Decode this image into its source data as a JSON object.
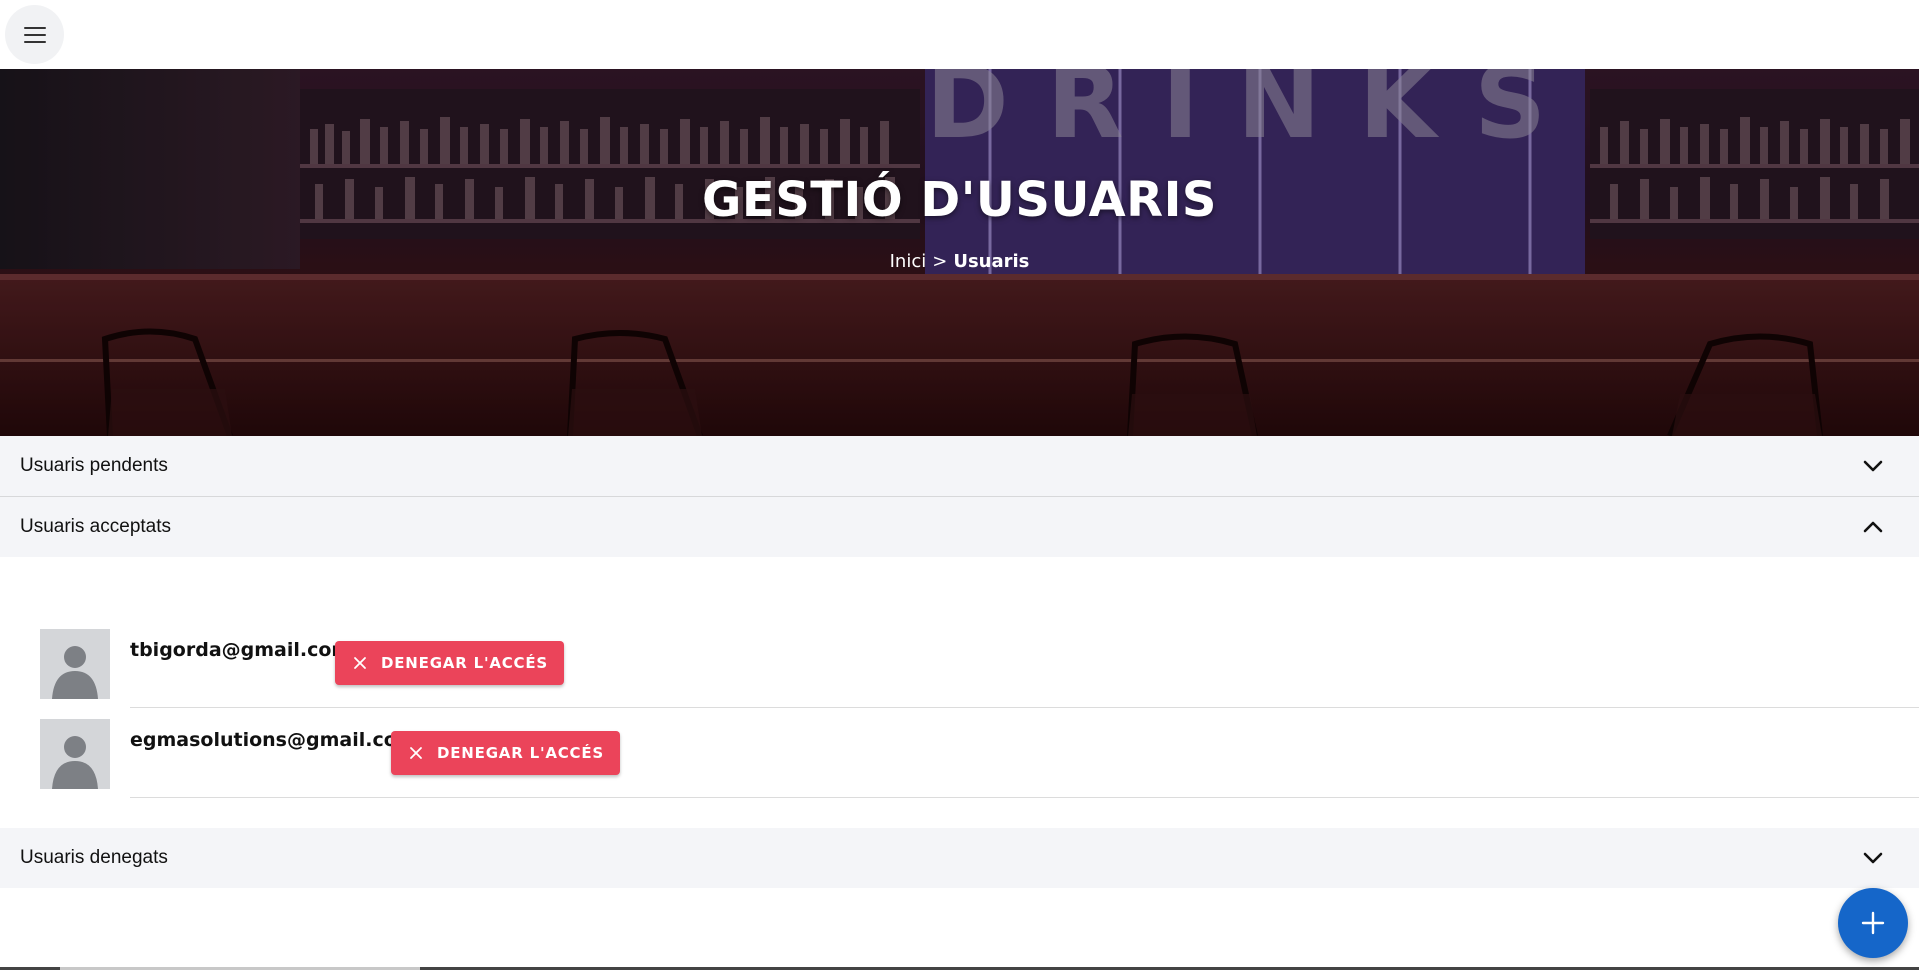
{
  "topbar": {
    "menu_icon": "hamburger-menu-icon"
  },
  "hero": {
    "title": "GESTIÓ D'USUARIS",
    "sign_text": "DRINKS",
    "breadcrumb": {
      "home": "Inici",
      "separator": ">",
      "current": "Usuaris"
    }
  },
  "sections": {
    "pending": {
      "label": "Usuaris pendents",
      "expanded": false,
      "icon": "chevron-down-icon"
    },
    "accepted": {
      "label": "Usuaris acceptats",
      "expanded": true,
      "icon": "chevron-up-icon",
      "users": [
        {
          "email": "tbigorda@gmail.com",
          "action_label": "DENEGAR L'ACCÉS",
          "avatar_icon": "person-avatar-icon"
        },
        {
          "email": "egmasolutions@gmail.com",
          "action_label": "DENEGAR L'ACCÉS",
          "avatar_icon": "person-avatar-icon"
        }
      ]
    },
    "denied": {
      "label": "Usuaris denegats",
      "expanded": false,
      "icon": "chevron-down-icon"
    }
  },
  "fab": {
    "icon": "plus-icon"
  },
  "colors": {
    "danger": "#eb445a",
    "primary": "#1566c9",
    "accordion_bg": "#f4f5f8"
  }
}
